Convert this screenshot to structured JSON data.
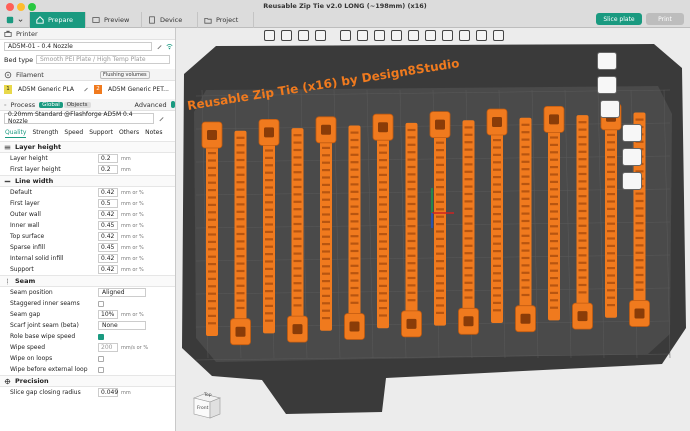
{
  "window": {
    "title": "Reusable Zip Tie v2.0 LONG (~198mm) (x16)"
  },
  "tabs": [
    {
      "label": "Prepare",
      "active": true,
      "icon": "home-icon"
    },
    {
      "label": "Preview",
      "active": false,
      "icon": "preview-icon"
    },
    {
      "label": "Device",
      "active": false,
      "icon": "device-icon"
    },
    {
      "label": "Project",
      "active": false,
      "icon": "project-icon"
    }
  ],
  "actions": {
    "slice": "Slice plate",
    "print": "Print"
  },
  "printer": {
    "section_label": "Printer",
    "name": "AD5M-01 - 0.4 Nozzle",
    "bed_type_label": "Bed type",
    "bed_type_value": "Smooth PEI Plate / High Temp Plate"
  },
  "filament": {
    "section_label": "Filament",
    "flushing": "Flushing volumes",
    "slots": [
      {
        "num": "1",
        "name": "AD5M Generic PLA",
        "color": "#e8d84a"
      },
      {
        "num": "2",
        "name": "AD5M Generic PET...",
        "color": "#f07a1e"
      }
    ]
  },
  "process": {
    "section_label": "Process",
    "global": "Global",
    "objects": "Objects",
    "advanced": "Advanced",
    "preset": "0.20mm Standard @Flashforge AD5M 0.4 Nozzle"
  },
  "param_tabs": [
    "Quality",
    "Strength",
    "Speed",
    "Support",
    "Others",
    "Notes"
  ],
  "groups": {
    "layer_height": {
      "title": "Layer height",
      "rows": [
        {
          "label": "Layer height",
          "value": "0.2",
          "unit": "mm"
        },
        {
          "label": "First layer height",
          "value": "0.2",
          "unit": "mm"
        }
      ]
    },
    "line_width": {
      "title": "Line width",
      "rows": [
        {
          "label": "Default",
          "value": "0.42",
          "unit": "mm or %"
        },
        {
          "label": "First layer",
          "value": "0.5",
          "unit": "mm or %"
        },
        {
          "label": "Outer wall",
          "value": "0.42",
          "unit": "mm or %"
        },
        {
          "label": "Inner wall",
          "value": "0.45",
          "unit": "mm or %"
        },
        {
          "label": "Top surface",
          "value": "0.42",
          "unit": "mm or %"
        },
        {
          "label": "Sparse infill",
          "value": "0.45",
          "unit": "mm or %"
        },
        {
          "label": "Internal solid infill",
          "value": "0.42",
          "unit": "mm or %"
        },
        {
          "label": "Support",
          "value": "0.42",
          "unit": "mm or %"
        }
      ]
    },
    "seam": {
      "title": "Seam",
      "seam_position": {
        "label": "Seam position",
        "value": "Aligned"
      },
      "staggered": {
        "label": "Staggered inner seams"
      },
      "seam_gap": {
        "label": "Seam gap",
        "value": "10%",
        "unit": "mm or %"
      },
      "scarf": {
        "label": "Scarf joint seam (beta)",
        "value": "None"
      },
      "role_base": {
        "label": "Role base wipe speed"
      },
      "wipe_speed": {
        "label": "Wipe speed",
        "value": "200",
        "unit": "mm/s or %"
      },
      "wipe_loops": {
        "label": "Wipe on loops"
      },
      "wipe_before": {
        "label": "Wipe before external loop"
      }
    },
    "precision": {
      "title": "Precision",
      "rows": [
        {
          "label": "Slice gap closing radius",
          "value": "0.049",
          "unit": "mm"
        }
      ]
    }
  },
  "bed_label": "Reusable Zip Tie (x16) by Design8Studio",
  "view_cube": {
    "top": "Top",
    "front": "Front"
  },
  "colors": {
    "accent": "#1a9a80",
    "part": "#f07a1e",
    "bed": "#3a3a3a"
  }
}
